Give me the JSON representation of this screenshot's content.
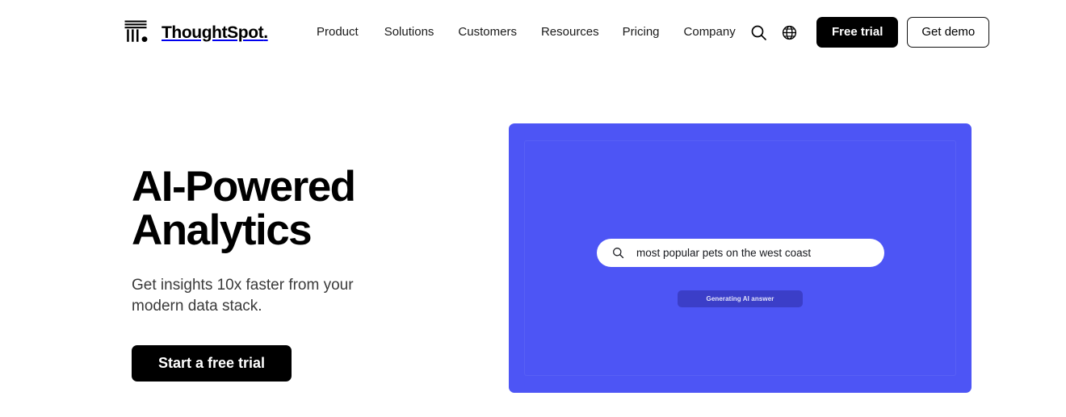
{
  "header": {
    "brand": {
      "name": "ThoughtSpot",
      "suffix": ".",
      "logo_icon": "thoughtspot-logo-icon"
    },
    "nav": [
      {
        "label": "Product"
      },
      {
        "label": "Solutions"
      },
      {
        "label": "Customers"
      },
      {
        "label": "Resources"
      },
      {
        "label": "Pricing"
      },
      {
        "label": "Company"
      }
    ],
    "actions": {
      "search_icon": "search-icon",
      "language_icon": "globe-icon",
      "free_trial_label": "Free trial",
      "get_demo_label": "Get demo"
    }
  },
  "hero": {
    "title_line_1": "AI-Powered",
    "title_line_2": "Analytics",
    "subtitle": "Get insights 10x faster from your modern data stack.",
    "cta_label": "Start a free trial"
  },
  "panel": {
    "background_color": "#4d55f5",
    "search": {
      "icon": "search-icon",
      "value": "most popular pets on the west coast",
      "placeholder": "most popular pets on the west coast"
    },
    "status": {
      "label": "Generating AI answer",
      "color": "#3b3ec8",
      "text_color": "#e3e4fb"
    }
  },
  "colors": {
    "accent_blue": "#4d55f5",
    "deep_indigo": "#3b3ec8",
    "black": "#000000",
    "white": "#ffffff",
    "body_text": "#3a3a3a"
  }
}
